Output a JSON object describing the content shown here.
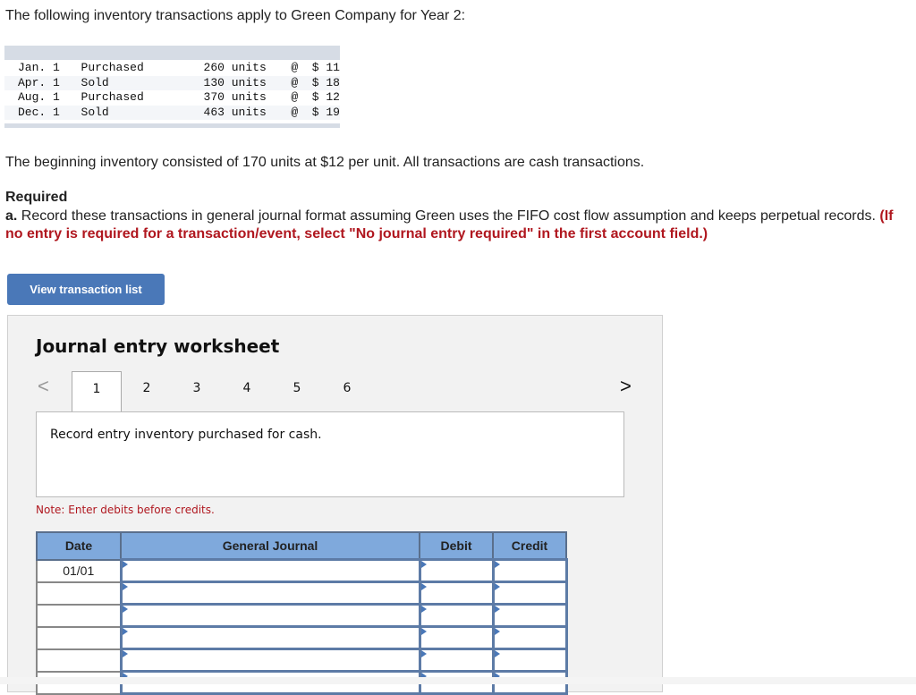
{
  "intro": "The following inventory transactions apply to Green Company for Year 2:",
  "transactions": [
    {
      "date": "Jan. 1",
      "type": "Purchased",
      "qty": "260 units",
      "at": "@",
      "price": "$ 11"
    },
    {
      "date": "Apr. 1",
      "type": "Sold",
      "qty": "130 units",
      "at": "@",
      "price": "$ 18"
    },
    {
      "date": "Aug. 1",
      "type": "Purchased",
      "qty": "370 units",
      "at": "@",
      "price": "$ 12"
    },
    {
      "date": "Dec. 1",
      "type": "Sold",
      "qty": "463 units",
      "at": "@",
      "price": "$ 19"
    }
  ],
  "beginning": "The beginning inventory consisted of 170 units at $12 per unit. All transactions are cash transactions.",
  "required": {
    "heading": "Required",
    "part_label": "a.",
    "text": " Record these transactions in general journal format assuming Green uses the FIFO cost flow assumption and keeps perpetual records. ",
    "instruction": "(If no entry is required for a transaction/event, select \"No journal entry required\" in the first account field.)"
  },
  "view_button": "View transaction list",
  "worksheet": {
    "title": "Journal entry worksheet",
    "prev": "<",
    "next": ">",
    "tabs": [
      "1",
      "2",
      "3",
      "4",
      "5",
      "6"
    ],
    "active_tab": "1",
    "description": "Record entry inventory purchased for cash.",
    "note": "Note: Enter debits before credits.",
    "columns": [
      "Date",
      "General Journal",
      "Debit",
      "Credit"
    ],
    "rows": [
      {
        "date": "01/01",
        "account": "",
        "debit": "",
        "credit": ""
      },
      {
        "date": "",
        "account": "",
        "debit": "",
        "credit": ""
      },
      {
        "date": "",
        "account": "",
        "debit": "",
        "credit": ""
      },
      {
        "date": "",
        "account": "",
        "debit": "",
        "credit": ""
      },
      {
        "date": "",
        "account": "",
        "debit": "",
        "credit": ""
      },
      {
        "date": "",
        "account": "",
        "debit": "",
        "credit": ""
      }
    ]
  }
}
